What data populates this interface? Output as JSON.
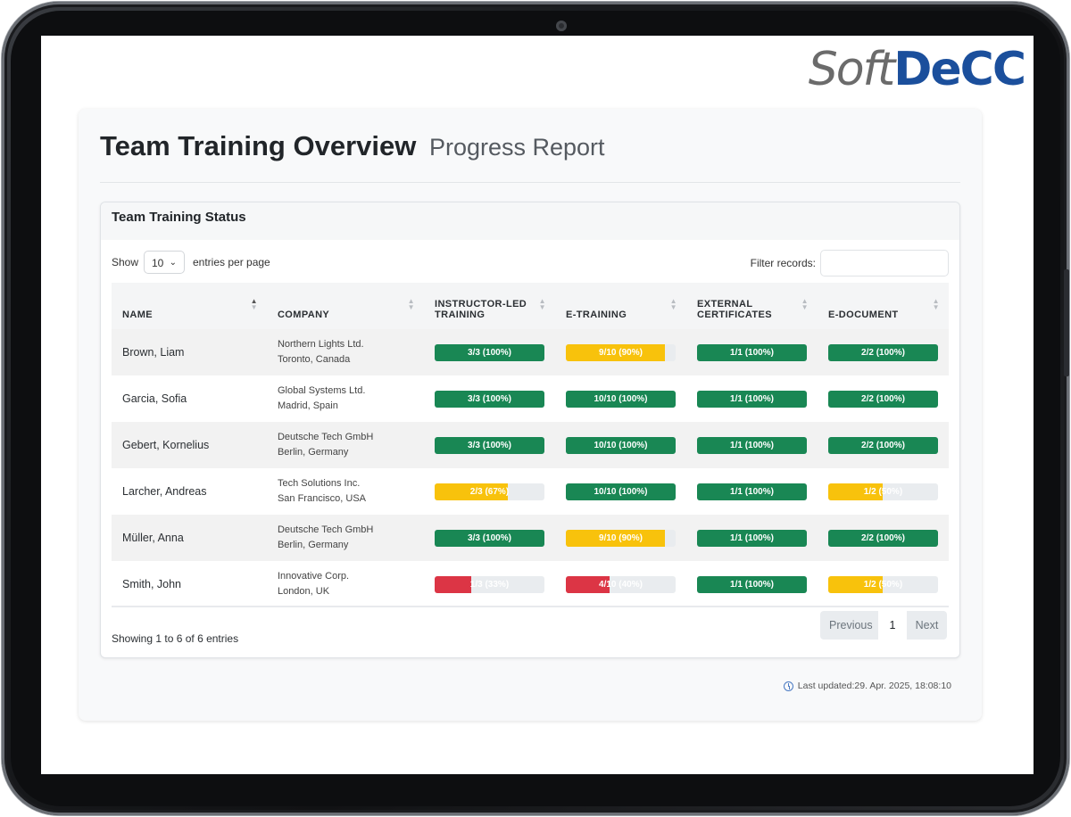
{
  "logo": {
    "soft": "Soft",
    "decc": "DeCC"
  },
  "header": {
    "title": "Team Training Overview",
    "subtitle": "Progress Report"
  },
  "panel": {
    "title": "Team Training Status"
  },
  "controls": {
    "show_label": "Show",
    "page_size": "10",
    "per_page_label": "entries per page",
    "filter_label": "Filter records:",
    "filter_value": ""
  },
  "columns": [
    "NAME",
    "COMPANY",
    "INSTRUCTOR-LED TRAINING",
    "E-TRAINING",
    "EXTERNAL CERTIFICATES",
    "E-DOCUMENT"
  ],
  "rows": [
    {
      "name": "Brown, Liam",
      "company": "Northern Lights Ltd.",
      "location": "Toronto, Canada",
      "progress": [
        {
          "label": "3/3 (100%)",
          "percent": 100,
          "status": "green"
        },
        {
          "label": "9/10 (90%)",
          "percent": 90,
          "status": "yellow"
        },
        {
          "label": "1/1 (100%)",
          "percent": 100,
          "status": "green"
        },
        {
          "label": "2/2 (100%)",
          "percent": 100,
          "status": "green"
        }
      ]
    },
    {
      "name": "Garcia, Sofia",
      "company": "Global Systems Ltd.",
      "location": "Madrid, Spain",
      "progress": [
        {
          "label": "3/3 (100%)",
          "percent": 100,
          "status": "green"
        },
        {
          "label": "10/10 (100%)",
          "percent": 100,
          "status": "green"
        },
        {
          "label": "1/1 (100%)",
          "percent": 100,
          "status": "green"
        },
        {
          "label": "2/2 (100%)",
          "percent": 100,
          "status": "green"
        }
      ]
    },
    {
      "name": "Gebert, Kornelius",
      "company": "Deutsche Tech GmbH",
      "location": "Berlin, Germany",
      "progress": [
        {
          "label": "3/3 (100%)",
          "percent": 100,
          "status": "green"
        },
        {
          "label": "10/10 (100%)",
          "percent": 100,
          "status": "green"
        },
        {
          "label": "1/1 (100%)",
          "percent": 100,
          "status": "green"
        },
        {
          "label": "2/2 (100%)",
          "percent": 100,
          "status": "green"
        }
      ]
    },
    {
      "name": "Larcher, Andreas",
      "company": "Tech Solutions Inc.",
      "location": "San Francisco, USA",
      "progress": [
        {
          "label": "2/3 (67%)",
          "percent": 67,
          "status": "yellow"
        },
        {
          "label": "10/10 (100%)",
          "percent": 100,
          "status": "green"
        },
        {
          "label": "1/1 (100%)",
          "percent": 100,
          "status": "green"
        },
        {
          "label": "1/2 (50%)",
          "percent": 50,
          "status": "yellow"
        }
      ]
    },
    {
      "name": "Müller, Anna",
      "company": "Deutsche Tech GmbH",
      "location": "Berlin, Germany",
      "progress": [
        {
          "label": "3/3 (100%)",
          "percent": 100,
          "status": "green"
        },
        {
          "label": "9/10 (90%)",
          "percent": 90,
          "status": "yellow"
        },
        {
          "label": "1/1 (100%)",
          "percent": 100,
          "status": "green"
        },
        {
          "label": "2/2 (100%)",
          "percent": 100,
          "status": "green"
        }
      ]
    },
    {
      "name": "Smith, John",
      "company": "Innovative Corp.",
      "location": "London, UK",
      "progress": [
        {
          "label": "1/3 (33%)",
          "percent": 33,
          "status": "red"
        },
        {
          "label": "4/10 (40%)",
          "percent": 40,
          "status": "red"
        },
        {
          "label": "1/1 (100%)",
          "percent": 100,
          "status": "green"
        },
        {
          "label": "1/2 (50%)",
          "percent": 50,
          "status": "yellow"
        }
      ]
    }
  ],
  "footer": {
    "showing": "Showing 1 to 6 of 6 entries",
    "prev": "Previous",
    "page": "1",
    "next": "Next",
    "last_updated": "Last updated:29. Apr. 2025, 18:08:10"
  },
  "colors": {
    "green": "#198754",
    "yellow": "#f8c20c",
    "red": "#dc3545",
    "brand": "#1b4f9c"
  },
  "icons": {
    "sort": "sort-arrows-icon",
    "clock": "clock-icon",
    "dropdown": "chevron-down-icon"
  }
}
